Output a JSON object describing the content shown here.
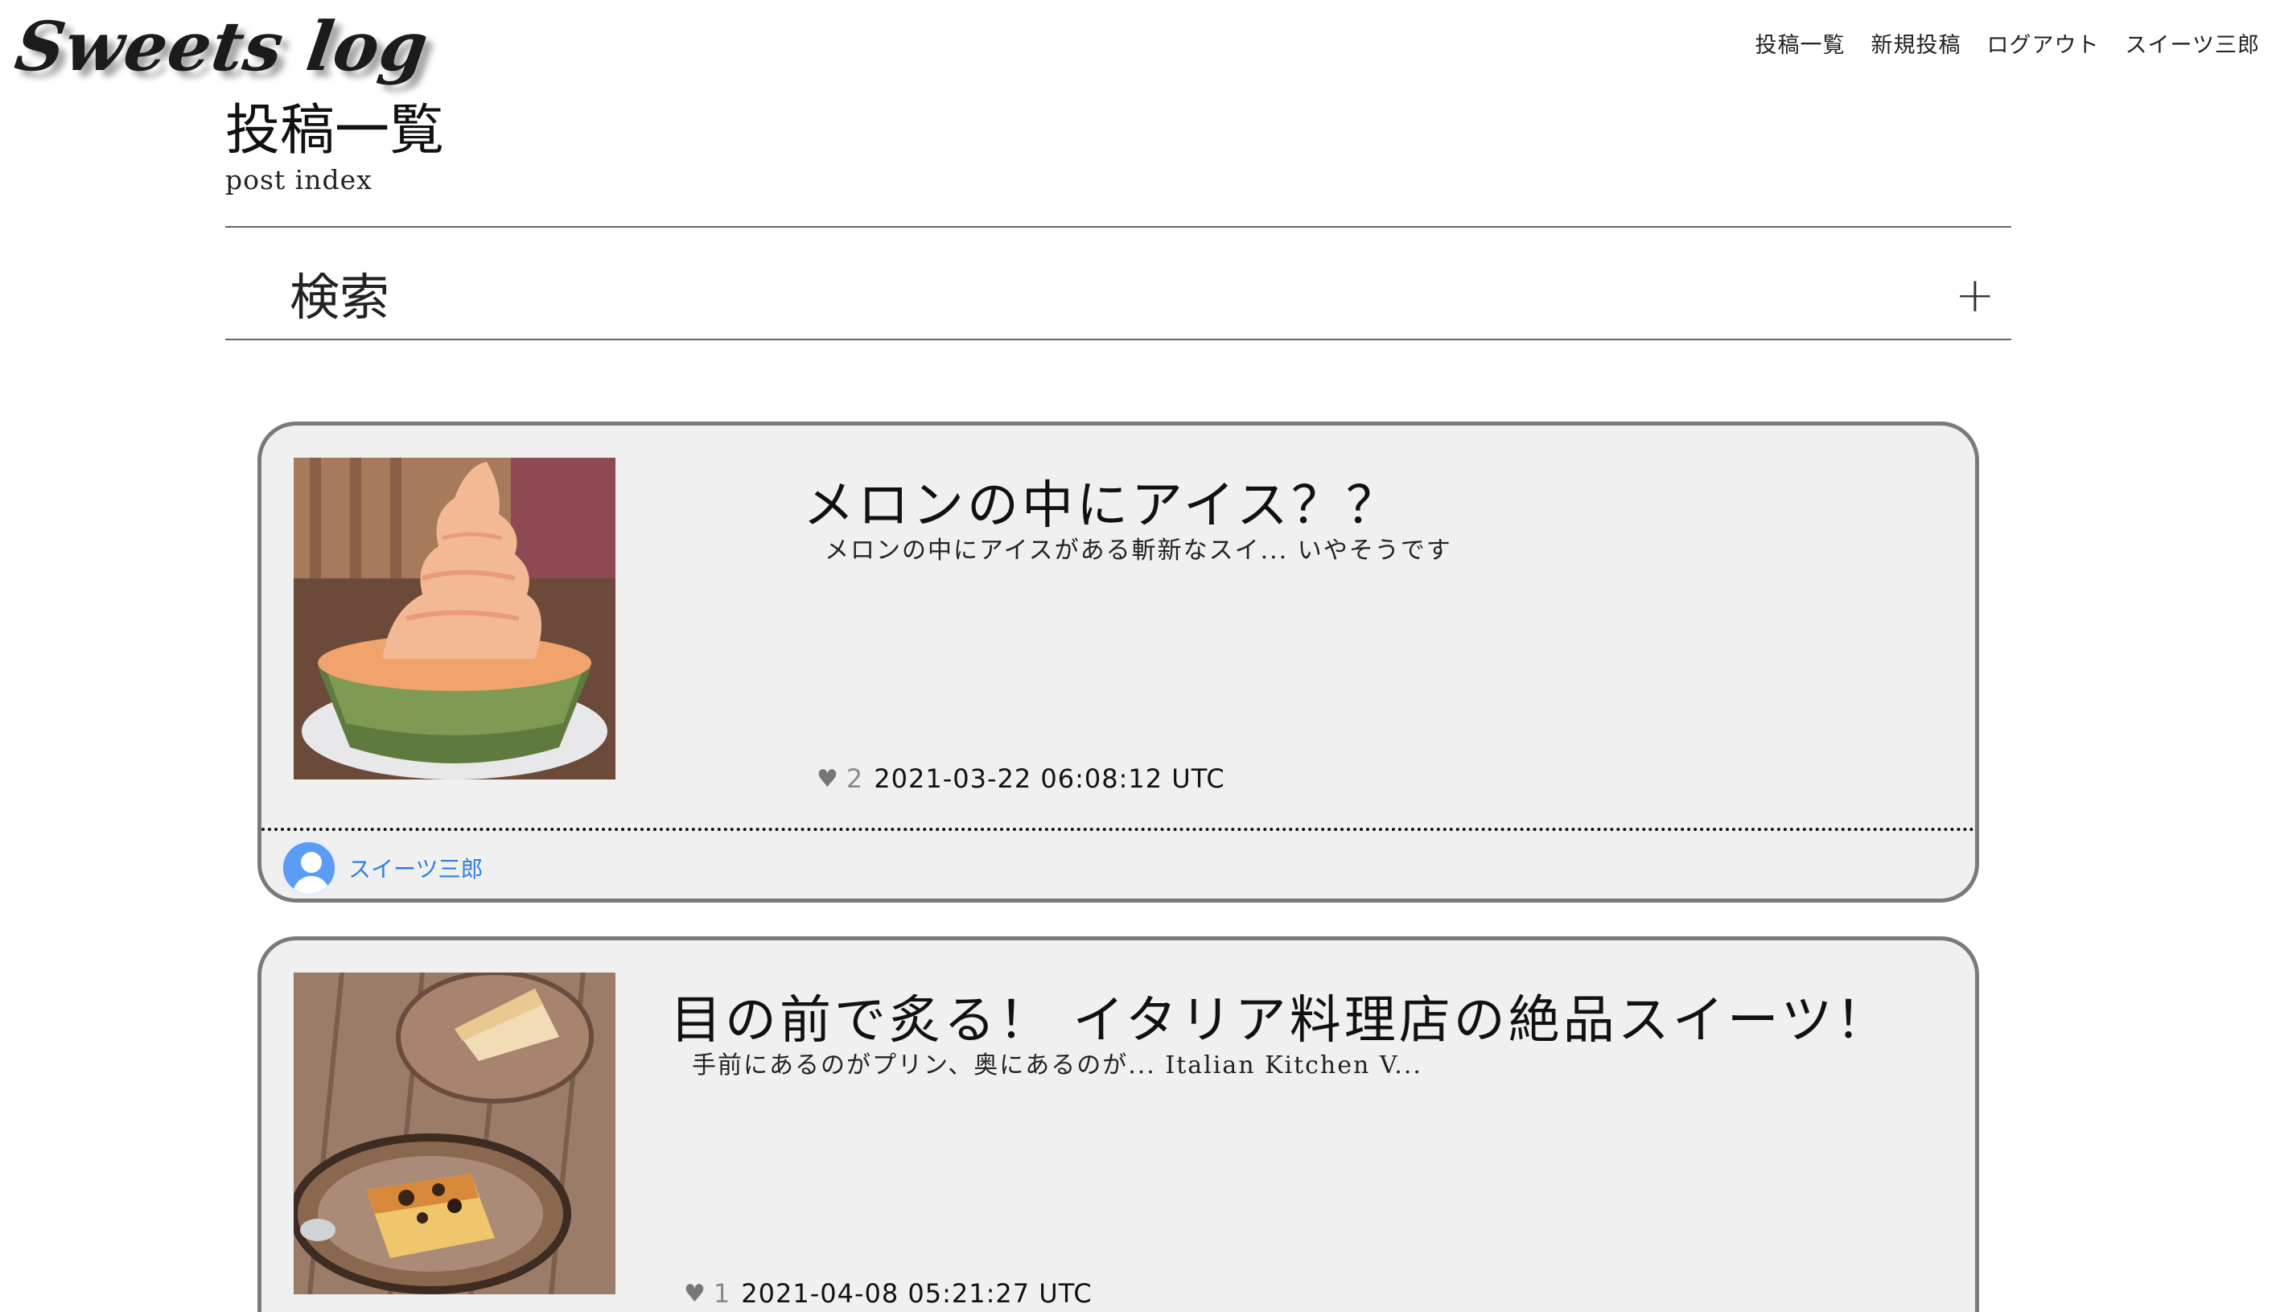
{
  "header": {
    "logo_text": "Sweets log",
    "nav": [
      "投稿一覧",
      "新規投稿",
      "ログアウト",
      "スイーツ三郎"
    ]
  },
  "page": {
    "title": "投稿一覧",
    "subtitle": "post index"
  },
  "search": {
    "label": "検索",
    "toggle_icon": "+"
  },
  "posts": [
    {
      "title": "メロンの中にアイス？？",
      "excerpt": "メロンの中にアイスがある斬新なスイ... いやそうです",
      "heart_icon": "♥",
      "likes": "2",
      "timestamp": "2021-03-22 06:08:12 UTC",
      "author": "スイーツ三郎",
      "image": "melon-soft-serve-photo"
    },
    {
      "title": "目の前で炙る！ イタリア料理店の絶品スイーツ！",
      "excerpt": "手前にあるのがプリン、奥にあるのが... Italian Kitchen V...",
      "heart_icon": "♥",
      "likes": "1",
      "timestamp": "2021-04-08 05:21:27 UTC",
      "author": "",
      "image": "pudding-cheesecake-photo"
    }
  ],
  "colors": {
    "card_bg": "#f0f0f0",
    "card_border": "#7a7a7a",
    "author_link": "#2f7fe0",
    "avatar": "#5b9cf4"
  }
}
